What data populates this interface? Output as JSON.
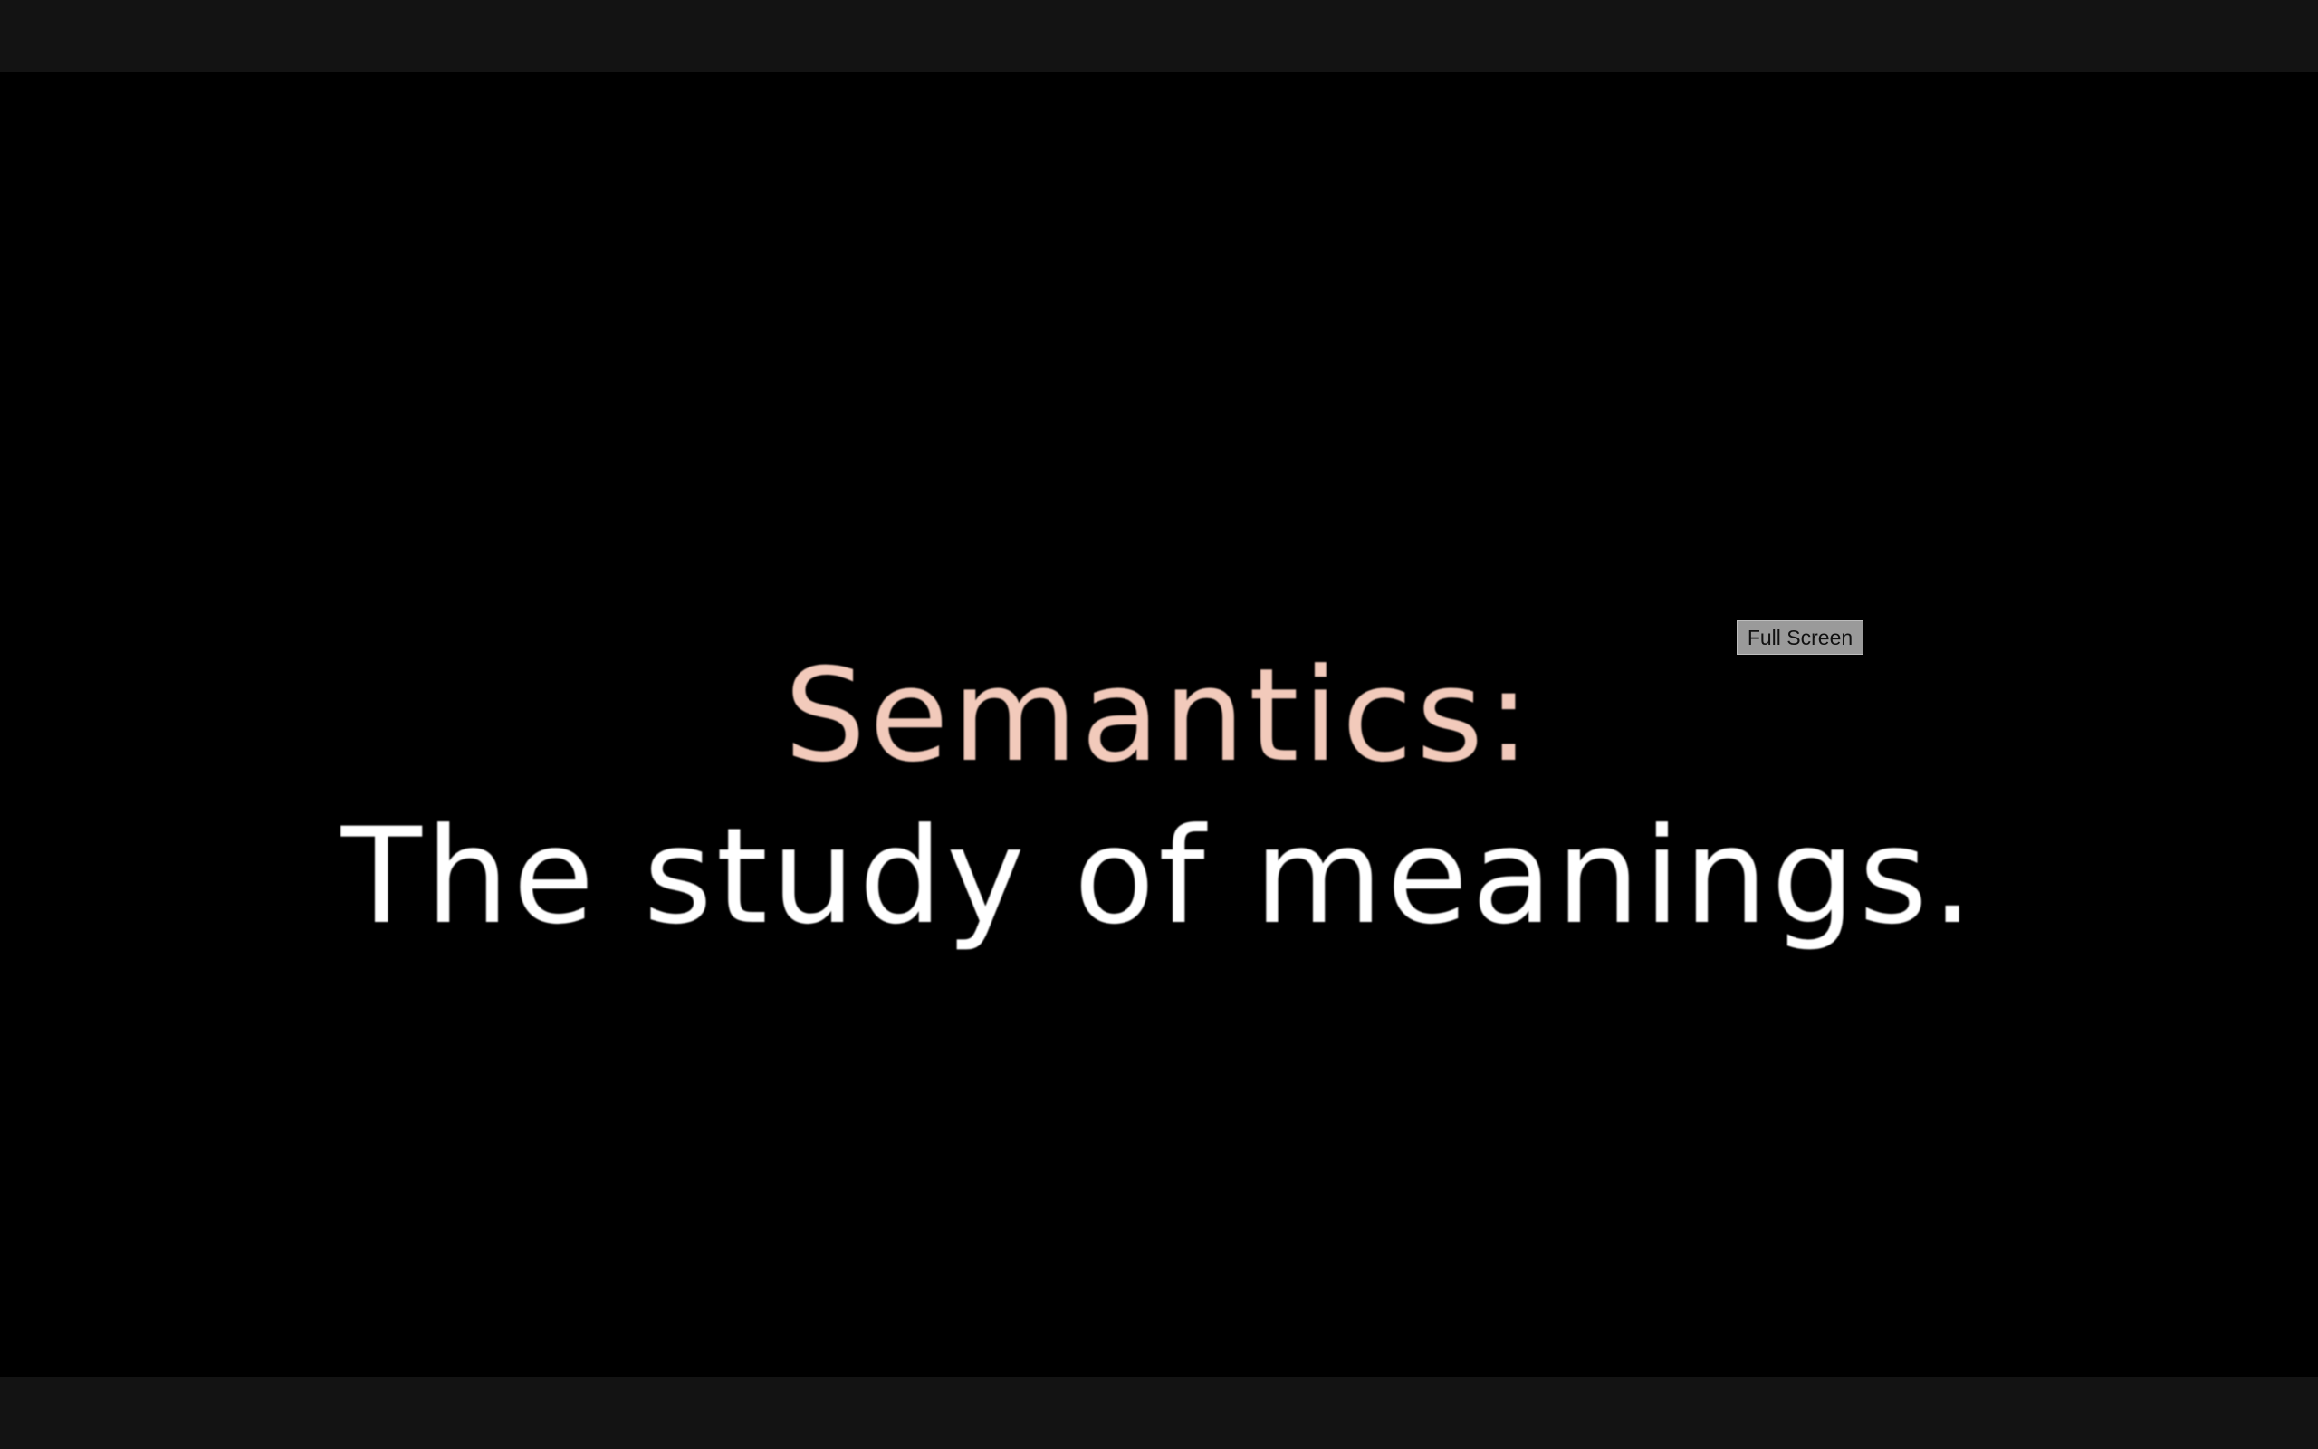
{
  "slide": {
    "heading": "Semantics:",
    "subheading": "The study of meanings.",
    "heading_color": "#f2cabb",
    "subheading_color": "#ffffff"
  },
  "player": {
    "fullscreen_label": "Full Screen",
    "background_color": "#000000",
    "chrome_color": "#131313"
  }
}
